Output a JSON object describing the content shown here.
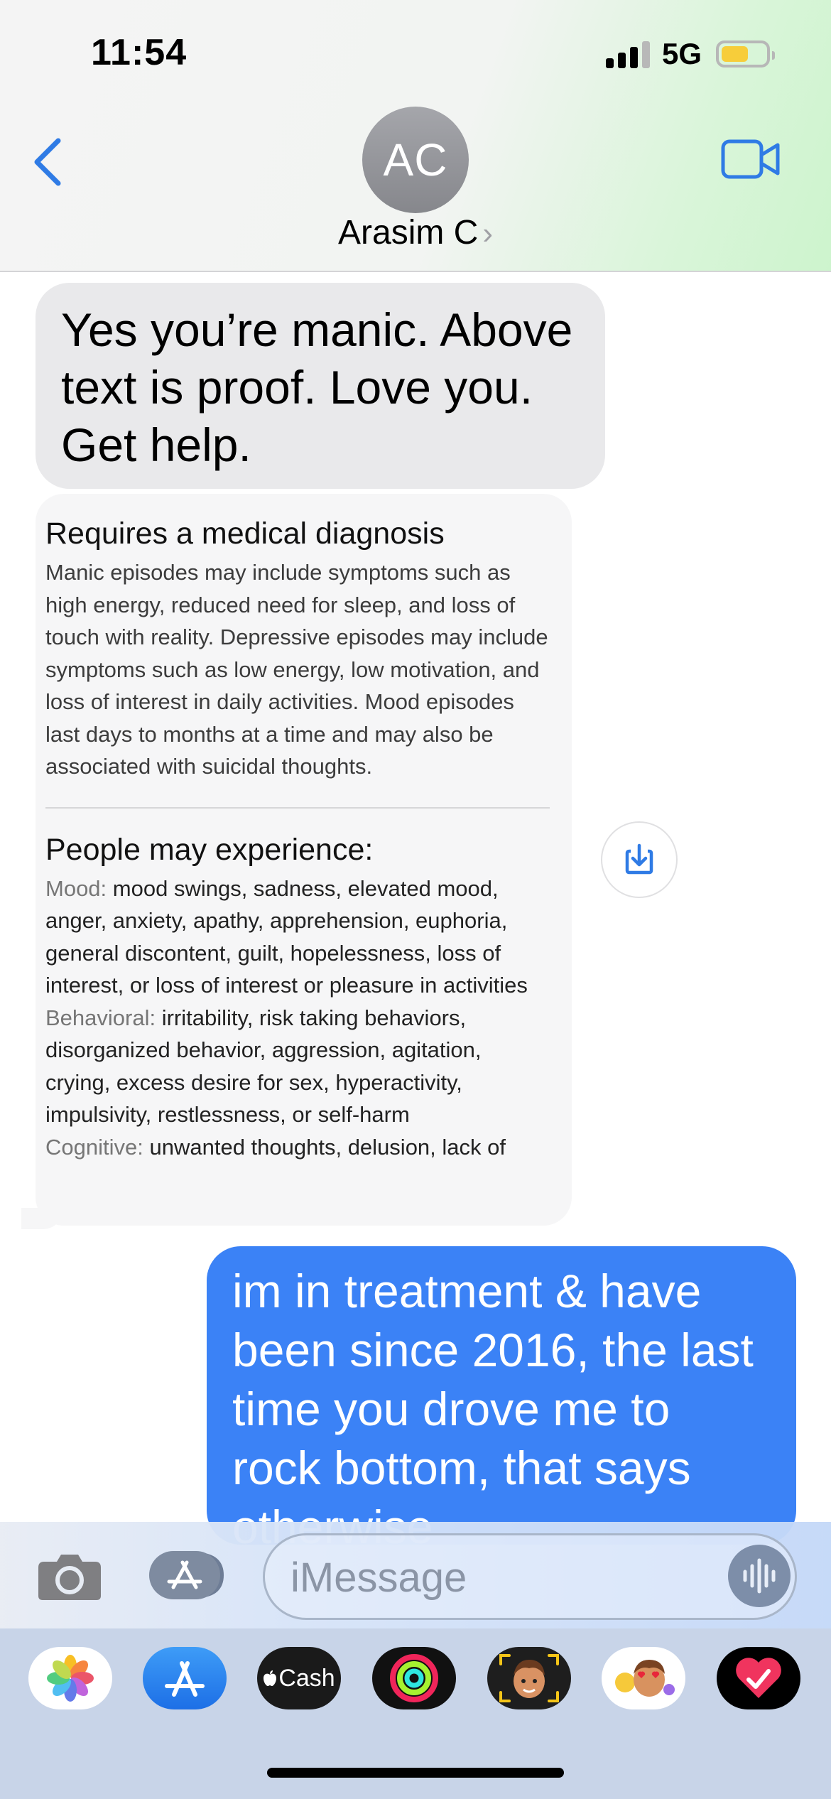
{
  "status_bar": {
    "time": "11:54",
    "network": "5G",
    "battery_fraction": 0.55
  },
  "header": {
    "avatar_initials": "AC",
    "contact_name": "Arasim C",
    "contact_chevron": "›"
  },
  "messages": {
    "incoming_text": "Yes you’re manic. Above text is proof. Love you. Get help.",
    "card": {
      "title": "Requires a medical diagnosis",
      "description": "Manic episodes may include symptoms such as high energy, reduced need for sleep, and loss of touch with reality. Depressive episodes may include symptoms such as low energy, low motivation, and loss of interest in daily activities. Mood episodes last days to months at a time and may also be associated with suicidal thoughts.",
      "experience_title": "People may experience:",
      "symptoms": [
        {
          "label": "Mood:",
          "text": "mood swings, sadness, elevated mood, anger, anxiety, apathy, apprehension, euphoria, general discontent, guilt, hopelessness, loss of interest, or loss of interest or pleasure in activities"
        },
        {
          "label": "Behavioral:",
          "text": "irritability, risk taking behaviors, disorganized behavior, aggression, agitation, crying, excess desire for sex, hyperactivity, impulsivity, restlessness, or self-harm"
        },
        {
          "label": "Cognitive:",
          "text": "unwanted thoughts, delusion, lack of"
        }
      ]
    },
    "outgoing_text": "im in treatment & have been since 2016, the last time you drove me to rock bottom, that says otherwise"
  },
  "input": {
    "placeholder": "iMessage",
    "value": ""
  },
  "app_drawer": {
    "apps": [
      "photos-app",
      "app-store",
      "apple-cash",
      "activity",
      "memoji-stickers",
      "memoji",
      "digital-touch"
    ],
    "cash_label": "Cash"
  },
  "colors": {
    "accent_blue": "#3b82f6",
    "incoming_bubble": "#e9e9eb",
    "ios_blue": "#2f7be5",
    "battery_yellow": "#f7cd3a"
  }
}
